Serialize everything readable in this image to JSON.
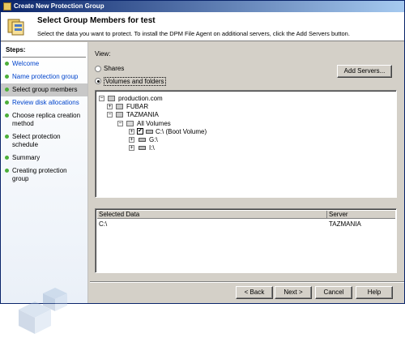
{
  "window": {
    "title": "Create New Protection Group"
  },
  "header": {
    "title": "Select Group Members for test",
    "description": "Select the data you want to protect. To install the DPM File Agent on additional servers, click the Add Servers button."
  },
  "steps": {
    "title": "Steps:",
    "items": [
      {
        "label": "Welcome",
        "state": "link"
      },
      {
        "label": "Name protection group",
        "state": "link"
      },
      {
        "label": "Select group members",
        "state": "selected"
      },
      {
        "label": "Review disk allocations",
        "state": "current"
      },
      {
        "label": "Choose replica creation method",
        "state": "normal"
      },
      {
        "label": "Select protection schedule",
        "state": "normal"
      },
      {
        "label": "Summary",
        "state": "normal"
      },
      {
        "label": "Creating protection group",
        "state": "normal"
      }
    ]
  },
  "view": {
    "label": "View:",
    "option_shares": "Shares",
    "option_volumes": "Volumes and folders",
    "selected": "Volumes and folders"
  },
  "add_servers_label": "Add Servers...",
  "tree": {
    "root": "production.com",
    "server1": "FUBAR",
    "server2": "TAZMANIA",
    "all_volumes": "All Volumes",
    "vol_c": "C:\\ (Boot Volume)",
    "vol_g": "G:\\",
    "vol_i": "I:\\"
  },
  "table": {
    "columns": [
      "Selected Data",
      "Server"
    ],
    "rows": [
      {
        "data": "C:\\",
        "server": "TAZMANIA"
      }
    ]
  },
  "buttons": {
    "back": "< Back",
    "next": "Next >",
    "cancel": "Cancel",
    "help": "Help"
  },
  "colors": {
    "title_bar_start": "#0a246a",
    "title_bar_end": "#a6caf0",
    "link": "#0044cc",
    "step_dot": "#4caf3a",
    "dialog_bg": "#d4d0c8"
  }
}
